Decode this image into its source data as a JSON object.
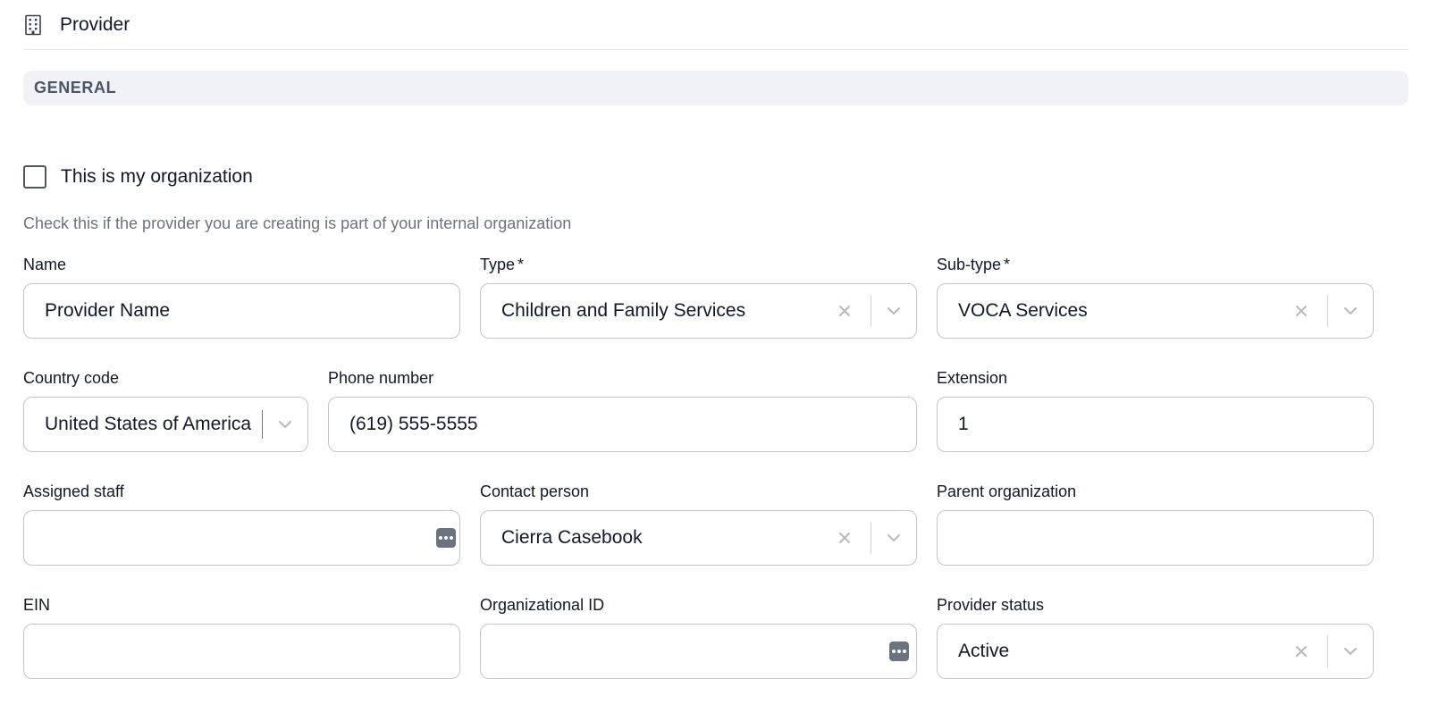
{
  "header": {
    "title": "Provider",
    "icon": "building-icon"
  },
  "section": {
    "title": "GENERAL"
  },
  "organization": {
    "checkbox_label": "This is my organization",
    "checked": false,
    "help_text": "Check this if the provider you are creating is part of your internal organization"
  },
  "fields": {
    "name": {
      "label": "Name",
      "value": "Provider Name"
    },
    "type": {
      "label": "Type",
      "required_mark": "*",
      "value": "Children and Family Services"
    },
    "subtype": {
      "label": "Sub-type",
      "required_mark": "*",
      "value": "VOCA Services"
    },
    "country_code": {
      "label": "Country code",
      "value": "United States of America"
    },
    "phone_number": {
      "label": "Phone number",
      "value": "(619) 555-5555"
    },
    "extension": {
      "label": "Extension",
      "value": "1"
    },
    "assigned_staff": {
      "label": "Assigned staff",
      "value": ""
    },
    "contact_person": {
      "label": "Contact person",
      "value": "Cierra Casebook"
    },
    "parent_org": {
      "label": "Parent organization",
      "value": ""
    },
    "ein": {
      "label": "EIN",
      "value": ""
    },
    "org_id": {
      "label": "Organizational ID",
      "value": ""
    },
    "provider_status": {
      "label": "Provider status",
      "value": "Active"
    }
  },
  "colors": {
    "border": "#c3c6cc",
    "section_bg": "#f1f1f8",
    "muted_text": "#6b7280",
    "icon_gray": "#b4b8bf"
  }
}
